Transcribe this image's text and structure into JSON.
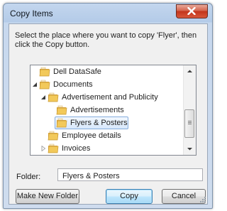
{
  "window": {
    "title": "Copy Items"
  },
  "instructions": "Select the place where you want to copy 'Flyer', then click the Copy button.",
  "tree": {
    "items": [
      {
        "label": "Dell DataSafe",
        "level": 1,
        "expanded": null,
        "selected": false
      },
      {
        "label": "Documents",
        "level": 1,
        "expanded": true,
        "selected": false
      },
      {
        "label": "Advertisement and Publicity",
        "level": 2,
        "expanded": true,
        "selected": false
      },
      {
        "label": "Advertisements",
        "level": 3,
        "expanded": null,
        "selected": false
      },
      {
        "label": "Flyers & Posters",
        "level": 3,
        "expanded": null,
        "selected": true
      },
      {
        "label": "Employee details",
        "level": 2,
        "expanded": null,
        "selected": false
      },
      {
        "label": "Invoices",
        "level": 2,
        "expanded": false,
        "selected": false
      }
    ]
  },
  "folder_field": {
    "label": "Folder:",
    "value": "Flyers & Posters"
  },
  "buttons": {
    "make_new_folder": "Make New Folder",
    "copy": "Copy",
    "cancel": "Cancel"
  },
  "colors": {
    "selection_border": "#84acdd",
    "folder": "#e8b84a",
    "close_button": "#c2341b"
  },
  "icons": {
    "close": "close-icon",
    "folder": "folder-icon",
    "expanded": "triangle-expanded-icon",
    "collapsed": "triangle-collapsed-icon"
  }
}
